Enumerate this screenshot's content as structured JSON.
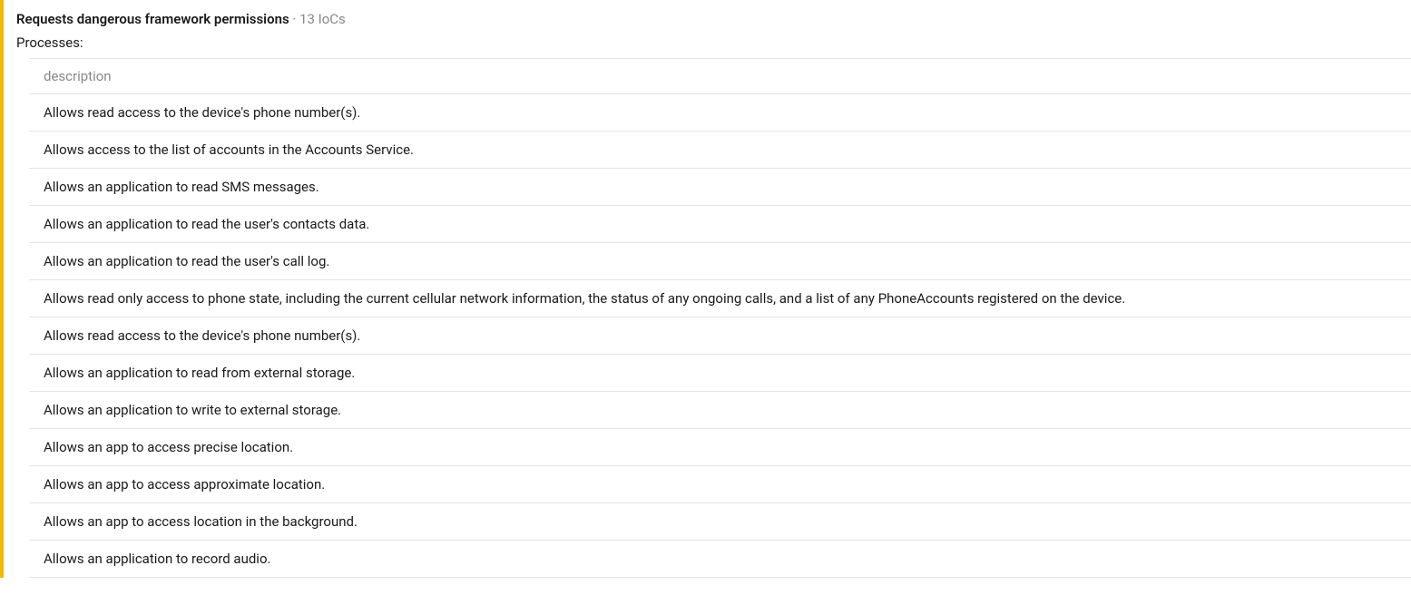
{
  "header": {
    "title": "Requests dangerous framework permissions",
    "separator": " · ",
    "ioc_count": "13 IoCs"
  },
  "processes_label": "Processes:",
  "table": {
    "column_header": "description",
    "rows": [
      "Allows read access to the device's phone number(s).",
      "Allows access to the list of accounts in the Accounts Service.",
      "Allows an application to read SMS messages.",
      "Allows an application to read the user's contacts data.",
      "Allows an application to read the user's call log.",
      "Allows read only access to phone state, including the current cellular network information, the status of any ongoing calls, and a list of any PhoneAccounts registered on the device.",
      "Allows read access to the device's phone number(s).",
      "Allows an application to read from external storage.",
      "Allows an application to write to external storage.",
      "Allows an app to access precise location.",
      "Allows an app to access approximate location.",
      "Allows an app to access location in the background.",
      "Allows an application to record audio."
    ]
  }
}
